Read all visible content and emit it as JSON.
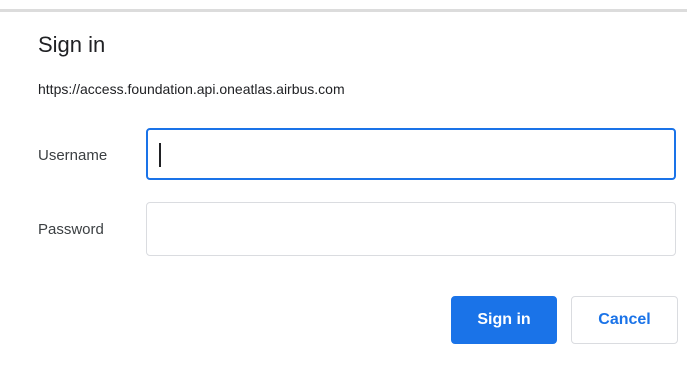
{
  "dialog": {
    "title": "Sign in",
    "origin": "https://access.foundation.api.oneatlas.airbus.com"
  },
  "fields": {
    "username_label": "Username",
    "username_value": "",
    "password_label": "Password",
    "password_value": ""
  },
  "buttons": {
    "sign_in_label": "Sign in",
    "cancel_label": "Cancel"
  },
  "colors": {
    "accent": "#1a73e8",
    "border": "#dadce0",
    "text": "#202124"
  }
}
